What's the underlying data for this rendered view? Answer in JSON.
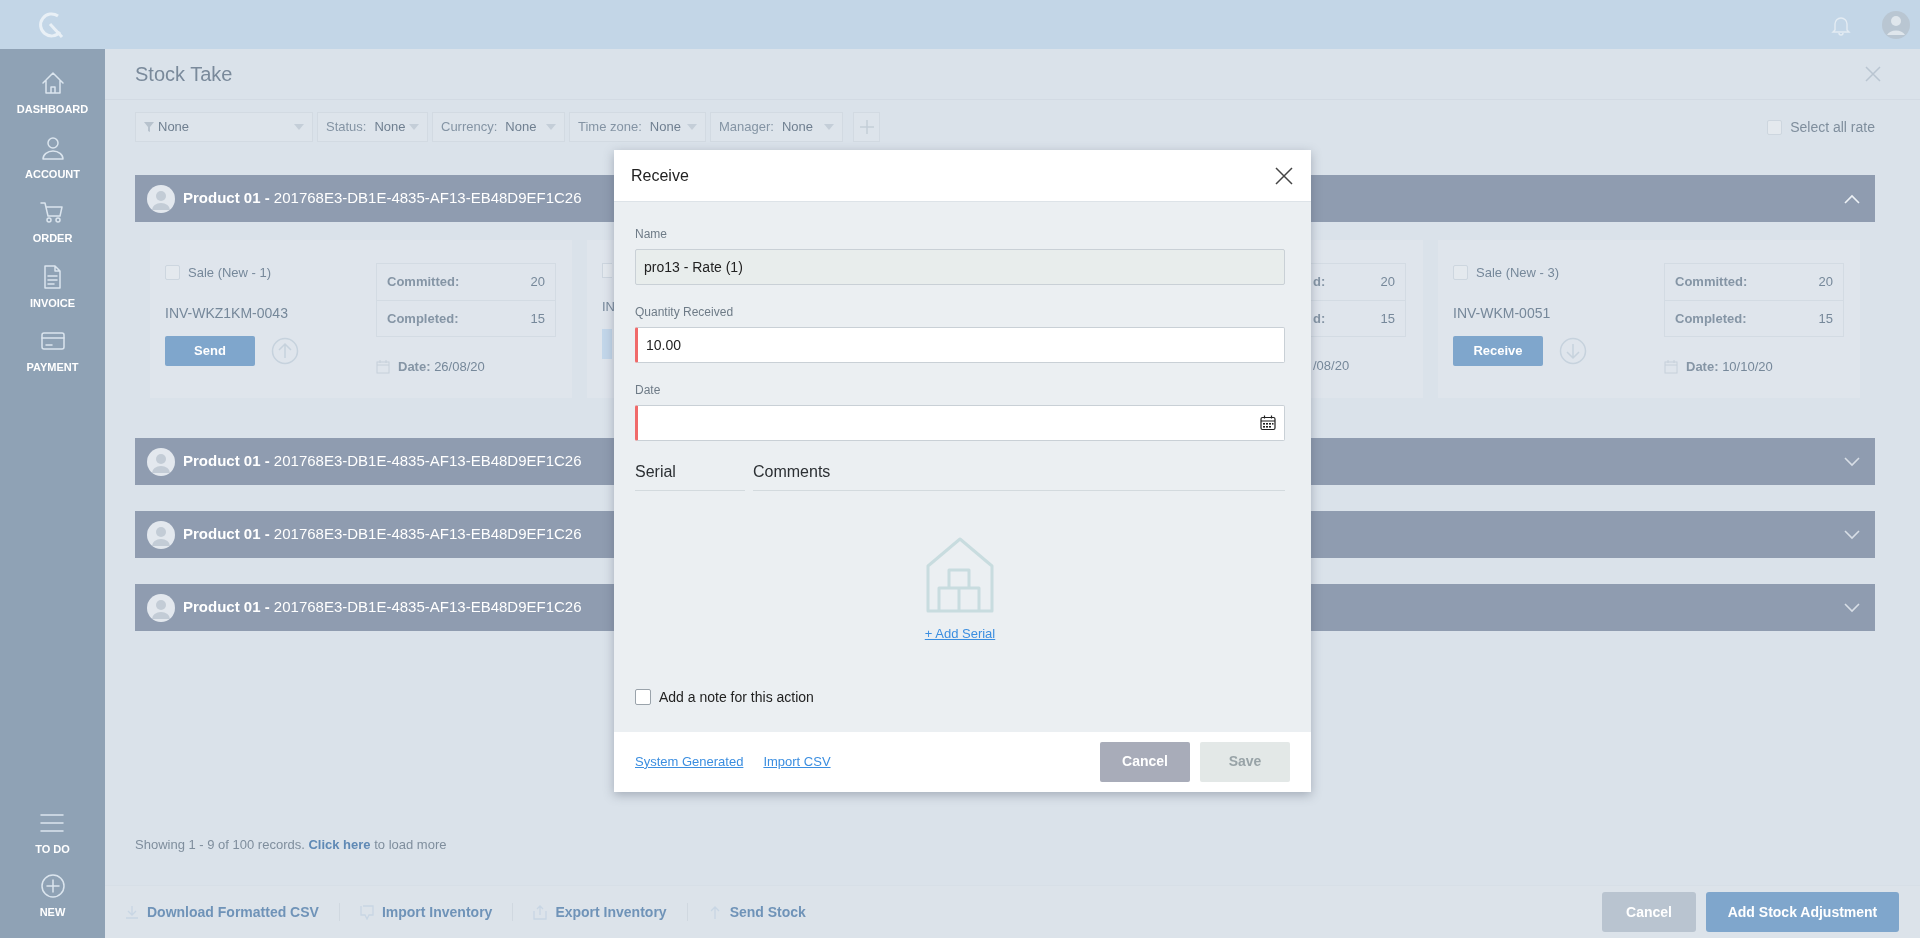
{
  "sidebar": {
    "items": [
      {
        "label": "DASHBOARD"
      },
      {
        "label": "ACCOUNT"
      },
      {
        "label": "ORDER"
      },
      {
        "label": "INVOICE"
      },
      {
        "label": "PAYMENT"
      }
    ],
    "bottom_items": [
      {
        "label": "TO DO"
      },
      {
        "label": "NEW"
      }
    ]
  },
  "page": {
    "title": "Stock Take"
  },
  "filters": [
    {
      "kind": "funnel",
      "value": "None"
    },
    {
      "kind": "labeled",
      "label": "Status:",
      "value": "None"
    },
    {
      "kind": "labeled",
      "label": "Currency:",
      "value": "None"
    },
    {
      "kind": "labeled",
      "label": "Time zone:",
      "value": "None"
    },
    {
      "kind": "labeled",
      "label": "Manager:",
      "value": "None"
    }
  ],
  "select_all": {
    "label": "Select all rate",
    "checked": false
  },
  "products": [
    {
      "title": "**Product 01 -** 201768E3-DB1E-4835-AF13-EB48D9EF1C26",
      "expanded": true,
      "cards": [
        {
          "kind": "full",
          "checked": false,
          "label": "Sale (New - 1)",
          "invoice": "INV-WKZ1KM-0043",
          "button": "Send",
          "stats": [
            {
              "label": "Committed:",
              "value": "20"
            },
            {
              "label": "Completed:",
              "value": "15"
            }
          ],
          "date_label": "Date:",
          "date": "26/08/20"
        },
        {
          "kind": "partial",
          "checked": false,
          "invoice": "IN",
          "stats": [
            {
              "label": "d:",
              "value": "20"
            },
            {
              "label": "d:",
              "value": "15"
            }
          ],
          "date": "/08/20"
        },
        {
          "kind": "full",
          "checked": false,
          "label": "Sale (New - 3)",
          "invoice": "INV-WKM-0051",
          "button": "Receive",
          "stats": [
            {
              "label": "Committed:",
              "value": "20"
            },
            {
              "label": "Completed:",
              "value": "15"
            }
          ],
          "date_label": "Date:",
          "date": "10/10/20"
        }
      ]
    },
    {
      "title": "**Product 01 -** 201768E3-DB1E-4835-AF13-EB48D9EF1C26",
      "expanded": false
    },
    {
      "title": "**Product 01 -** 201768E3-DB1E-4835-AF13-EB48D9EF1C26",
      "expanded": false
    },
    {
      "title": "**Product 01 -** 201768E3-DB1E-4835-AF13-EB48D9EF1C26",
      "expanded": false
    }
  ],
  "records_note": {
    "before": "Showing 1 - 9  of 100 records.",
    "link": "Click here",
    "after": "to load more"
  },
  "bottom_actions": [
    {
      "label": "Download Formatted CSV"
    },
    {
      "label": "Import Inventory"
    },
    {
      "label": "Export Inventory"
    },
    {
      "label": "Send Stock"
    }
  ],
  "bottom_buttons": [
    {
      "kind": "secondary",
      "label": "Cancel"
    },
    {
      "kind": "primary",
      "label": "Add Stock Adjustment"
    }
  ],
  "modal": {
    "title": "Receive",
    "fields": [
      {
        "kind": "text",
        "label": "Name",
        "value": "pro13 - Rate (1)",
        "readonly": true,
        "invalid": false
      },
      {
        "kind": "text",
        "label": "Quantity Received",
        "value": "10.00",
        "readonly": false,
        "invalid": true
      },
      {
        "kind": "date",
        "label": "Date",
        "readonly": false,
        "invalid": true
      }
    ],
    "columns": [
      "Serial",
      "Comments"
    ],
    "add_serial": "+ Add Serial",
    "note": {
      "label": "Add a note for this action",
      "checked": false
    },
    "links": [
      "System Generated",
      "Import CSV"
    ],
    "buttons": [
      {
        "label": "Cancel",
        "disabled": false
      },
      {
        "label": "Save",
        "disabled": true
      }
    ]
  }
}
